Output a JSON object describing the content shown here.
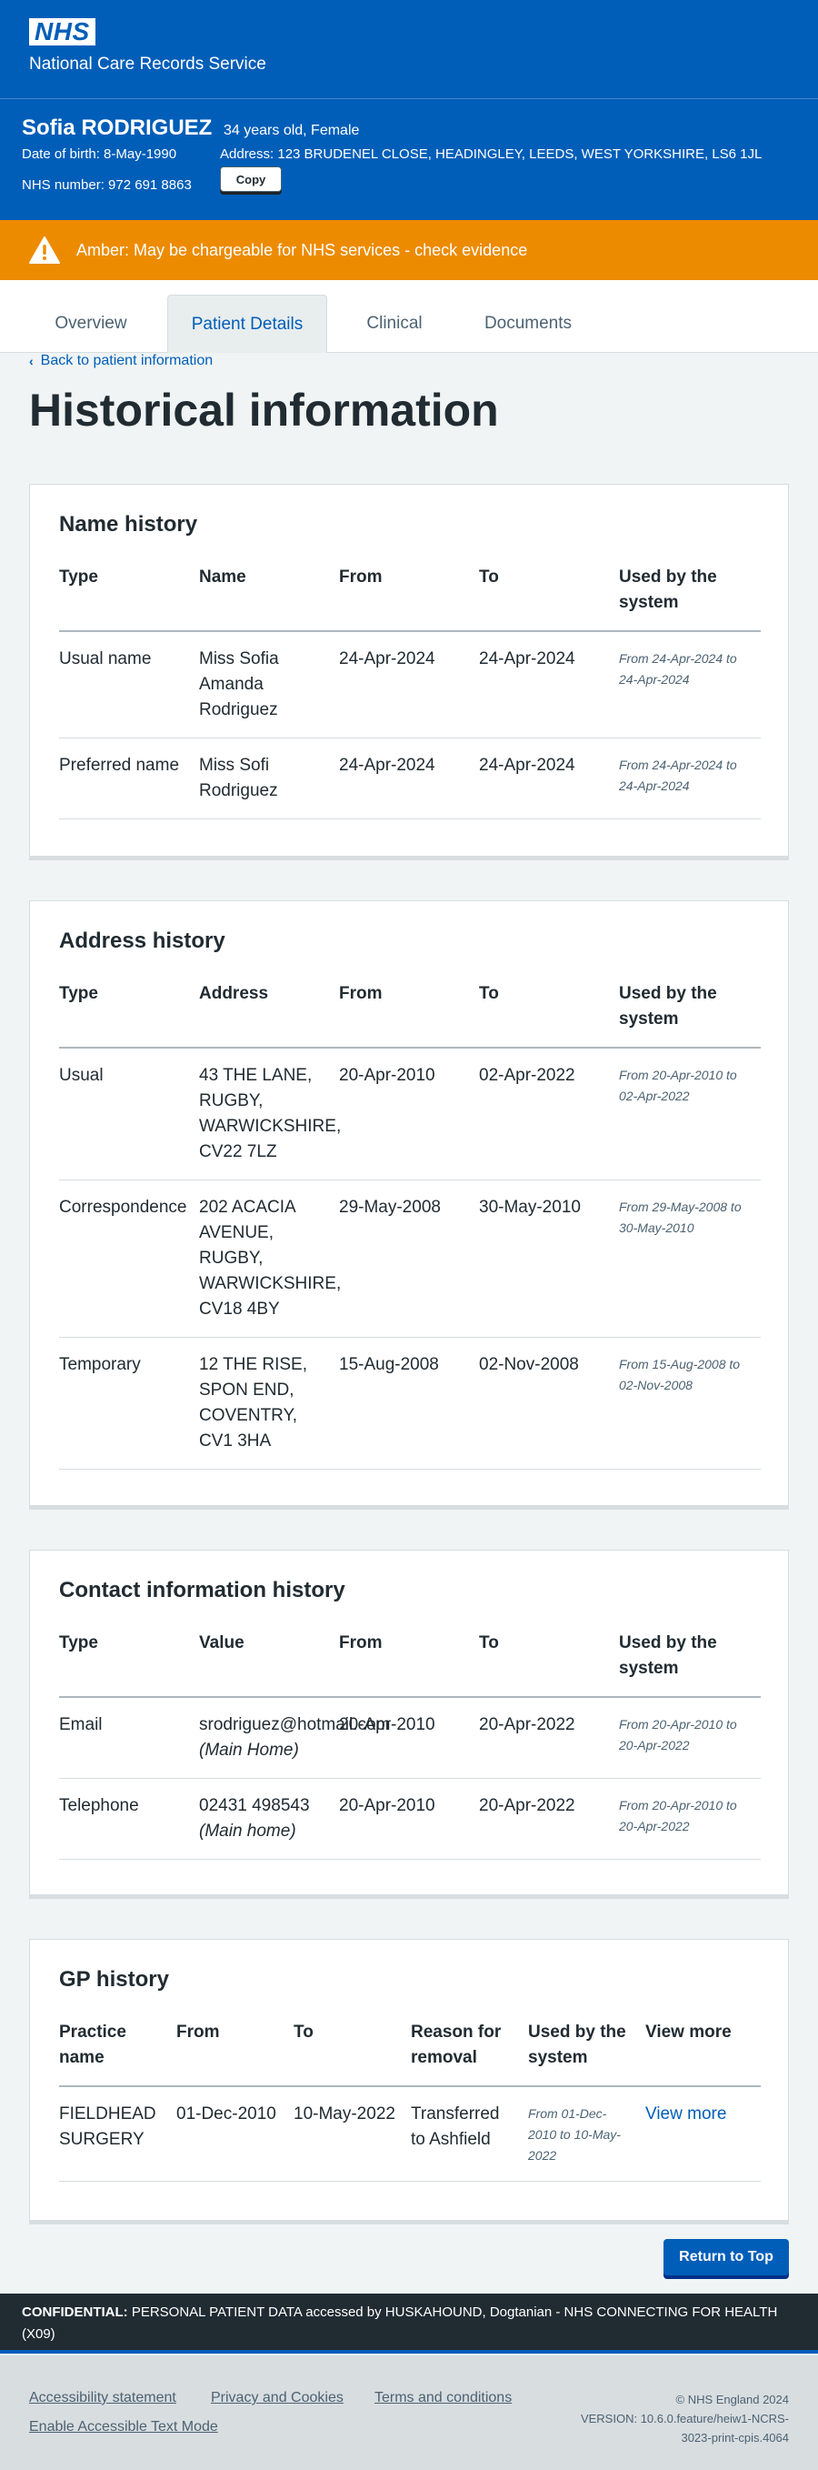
{
  "header": {
    "logo": "NHS",
    "service_name": "National Care Records Service"
  },
  "patient": {
    "name": "Sofia RODRIGUEZ",
    "age_sex": "34 years old, Female",
    "dob": "Date of birth: 8-May-1990",
    "address": "Address: 123 BRUDENEL CLOSE, HEADINGLEY, LEEDS, WEST YORKSHIRE, LS6 1JL",
    "nhs_number": "NHS number: 972 691 8863",
    "copy_label": "Copy"
  },
  "alert": {
    "text": "Amber: May be chargeable for NHS services - check evidence",
    "color": "#ed8b00"
  },
  "tabs": [
    {
      "label": "Overview"
    },
    {
      "label": "Patient Details"
    },
    {
      "label": "Clinical"
    },
    {
      "label": "Documents"
    }
  ],
  "back_link": "Back to patient information",
  "page_title": "Historical information",
  "name_history": {
    "title": "Name history",
    "headers": [
      "Type",
      "Name",
      "From",
      "To",
      "Used by the system"
    ],
    "rows": [
      [
        "Usual name",
        "Miss Sofia Amanda Rodriguez",
        "24-Apr-2024",
        "24-Apr-2024",
        "From 24-Apr-2024 to 24-Apr-2024"
      ],
      [
        "Preferred name",
        "Miss Sofi Rodriguez",
        "24-Apr-2024",
        "24-Apr-2024",
        "From 24-Apr-2024 to 24-Apr-2024"
      ]
    ]
  },
  "address_history": {
    "title": "Address history",
    "headers": [
      "Type",
      "Address",
      "From",
      "To",
      "Used by the system"
    ],
    "rows": [
      [
        "Usual",
        "43 THE LANE, RUGBY, WARWICKSHIRE, CV22 7LZ",
        "20-Apr-2010",
        "02-Apr-2022",
        "From 20-Apr-2010 to 02-Apr-2022"
      ],
      [
        "Correspondence",
        "202 ACACIA AVENUE, RUGBY, WARWICKSHIRE, CV18 4BY",
        "29-May-2008",
        "30-May-2010",
        "From 29-May-2008 to 30-May-2010"
      ],
      [
        "Temporary",
        "12 THE RISE, SPON END, COVENTRY, CV1 3HA",
        "15-Aug-2008",
        "02-Nov-2008",
        "From 15-Aug-2008 to 02-Nov-2008"
      ]
    ]
  },
  "contact_history": {
    "title": "Contact information history",
    "headers": [
      "Type",
      "Value",
      "From",
      "To",
      "Used by the system"
    ],
    "rows": [
      [
        "Email",
        "srodriguez@hotmail.com",
        "(Main Home)",
        "20-Apr-2010",
        "20-Apr-2022",
        "From 20-Apr-2010 to 20-Apr-2022"
      ],
      [
        "Telephone",
        "02431 498543",
        "(Main home)",
        "20-Apr-2010",
        "20-Apr-2022",
        "From 20-Apr-2010 to 20-Apr-2022"
      ]
    ]
  },
  "gp_history": {
    "title": "GP history",
    "headers": [
      "Practice name",
      "From",
      "To",
      "Reason for removal",
      "Used by the system",
      "View more"
    ],
    "rows": [
      [
        "FIELDHEAD SURGERY",
        "01-Dec-2010",
        "10-May-2022",
        "Transferred to Ashfield",
        "From 01-Dec-2010 to 10-May-2022",
        "View more"
      ]
    ]
  },
  "return_button": "Return to Top",
  "confidential": {
    "label": "CONFIDENTIAL:",
    "text": "PERSONAL PATIENT DATA accessed by HUSKAHOUND, Dogtanian - NHS CONNECTING FOR HEALTH (X09)"
  },
  "footer": {
    "links": [
      "Accessibility statement",
      "Privacy and Cookies",
      "Terms and conditions",
      "Enable Accessible Text Mode"
    ],
    "copyright": "© NHS England 2024",
    "version": "VERSION: 10.6.0.feature/heiw1-NCRS-3023-print-cpis.4064"
  },
  "colors": {
    "nhs_blue": "#005eb8",
    "amber": "#ed8b00",
    "dark": "#212b32"
  }
}
